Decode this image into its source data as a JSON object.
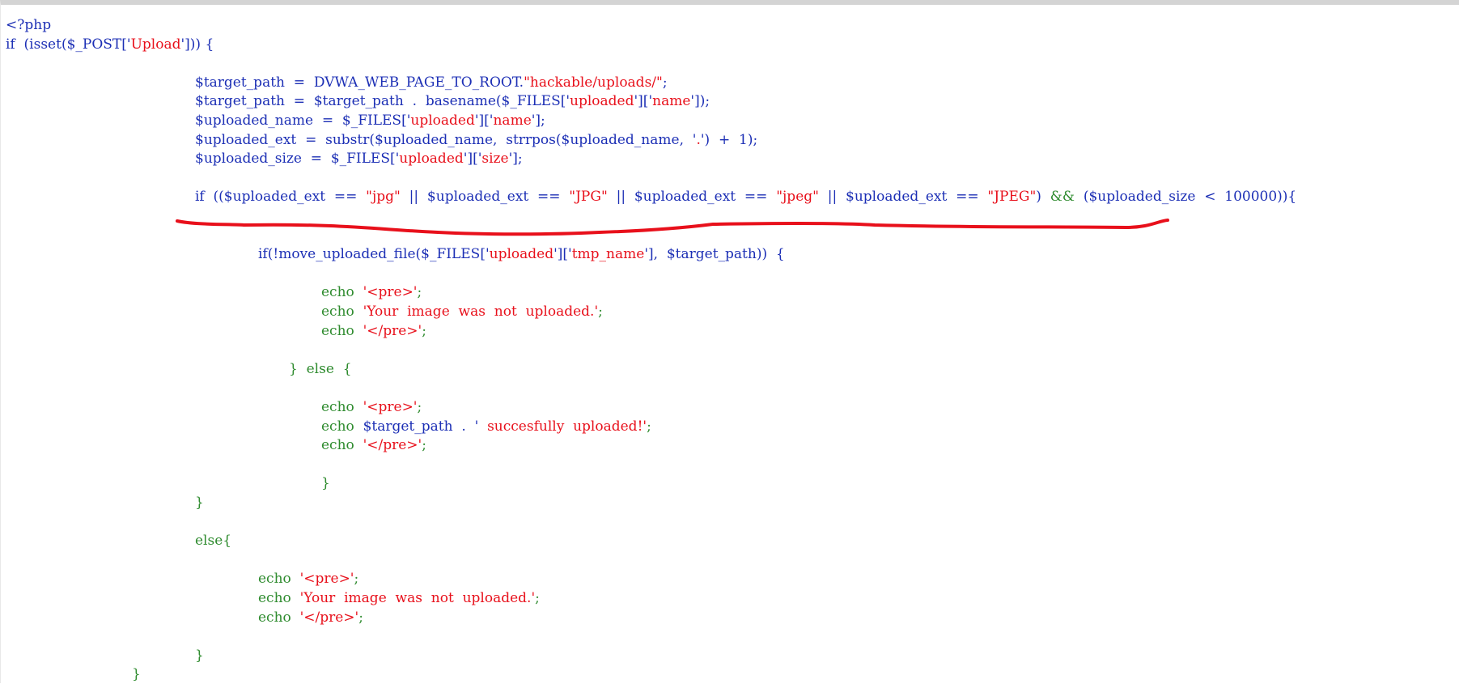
{
  "editor": {
    "lines": [
      {
        "tokens": [
          {
            "text": "<?php",
            "c": "b"
          }
        ]
      },
      {
        "tokens": [
          {
            "text": "if  (",
            "c": "b"
          },
          {
            "text": "isset",
            "c": "b"
          },
          {
            "text": "($_POST['",
            "c": "b"
          },
          {
            "text": "Upload",
            "c": "s"
          },
          {
            "text": "'])) {",
            "c": "b"
          }
        ]
      },
      {
        "tokens": []
      },
      {
        "tokens": [
          {
            "text": "$target_path  =  DVWA_WEB_PAGE_TO_ROOT.",
            "c": "b"
          },
          {
            "text": "\"hackable/uploads/\"",
            "c": "s"
          },
          {
            "text": ";",
            "c": "b"
          }
        ]
      },
      {
        "tokens": [
          {
            "text": "$target_path  =  $target_path  .  basename($_FILES['",
            "c": "b"
          },
          {
            "text": "uploaded",
            "c": "s"
          },
          {
            "text": "']['",
            "c": "b"
          },
          {
            "text": "name",
            "c": "s"
          },
          {
            "text": "']);",
            "c": "b"
          }
        ]
      },
      {
        "tokens": [
          {
            "text": "$uploaded_name  =  $_FILES['",
            "c": "b"
          },
          {
            "text": "uploaded",
            "c": "s"
          },
          {
            "text": "']['",
            "c": "b"
          },
          {
            "text": "name",
            "c": "s"
          },
          {
            "text": "'];",
            "c": "b"
          }
        ]
      },
      {
        "tokens": [
          {
            "text": "$uploaded_ext  =  substr($uploaded_name,  strrpos($uploaded_name,  '",
            "c": "b"
          },
          {
            "text": ".",
            "c": "s"
          },
          {
            "text": "')  +  1);",
            "c": "b"
          }
        ]
      },
      {
        "tokens": [
          {
            "text": "$uploaded_size  =  $_FILES['",
            "c": "b"
          },
          {
            "text": "uploaded",
            "c": "s"
          },
          {
            "text": "']['",
            "c": "b"
          },
          {
            "text": "size",
            "c": "s"
          },
          {
            "text": "'];",
            "c": "b"
          }
        ]
      },
      {
        "tokens": []
      },
      {
        "tokens": [
          {
            "text": "if  (($uploaded_ext  ==  ",
            "c": "b"
          },
          {
            "text": "\"jpg\"",
            "c": "s"
          },
          {
            "text": "  ||  $uploaded_ext  ==  ",
            "c": "b"
          },
          {
            "text": "\"JPG\"",
            "c": "s"
          },
          {
            "text": "  ||  $uploaded_ext  ==  ",
            "c": "b"
          },
          {
            "text": "\"jpeg\"",
            "c": "s"
          },
          {
            "text": "  ||  $uploaded_ext  ==  ",
            "c": "b"
          },
          {
            "text": "\"JPEG\"",
            "c": "s"
          },
          {
            "text": ")  ",
            "c": "b"
          },
          {
            "text": "&&",
            "c": "k"
          },
          {
            "text": "  ($uploaded_size  <  100000)){",
            "c": "b"
          }
        ]
      },
      {
        "tokens": []
      },
      {
        "tokens": []
      },
      {
        "tokens": [
          {
            "text": "if(!move_uploaded_file($_FILES['",
            "c": "b"
          },
          {
            "text": "uploaded",
            "c": "s"
          },
          {
            "text": "']['",
            "c": "b"
          },
          {
            "text": "tmp_name",
            "c": "s"
          },
          {
            "text": "'],  $target_path))  {",
            "c": "b"
          }
        ]
      },
      {
        "tokens": []
      },
      {
        "tokens": [
          {
            "text": "echo  ",
            "c": "k"
          },
          {
            "text": "'<pre>'",
            "c": "s"
          },
          {
            "text": ";",
            "c": "k"
          }
        ]
      },
      {
        "tokens": [
          {
            "text": "echo  ",
            "c": "k"
          },
          {
            "text": "'Your  image  was  not  uploaded.'",
            "c": "s"
          },
          {
            "text": ";",
            "c": "k"
          }
        ]
      },
      {
        "tokens": [
          {
            "text": "echo  ",
            "c": "k"
          },
          {
            "text": "'</pre>'",
            "c": "s"
          },
          {
            "text": ";",
            "c": "k"
          }
        ]
      },
      {
        "tokens": []
      },
      {
        "tokens": [
          {
            "text": "}  else  {",
            "c": "k"
          }
        ]
      },
      {
        "tokens": []
      },
      {
        "tokens": [
          {
            "text": "echo  ",
            "c": "k"
          },
          {
            "text": "'<pre>'",
            "c": "s"
          },
          {
            "text": ";",
            "c": "k"
          }
        ]
      },
      {
        "tokens": [
          {
            "text": "echo  ",
            "c": "k"
          },
          {
            "text": "$target_path  .  '",
            "c": "b"
          },
          {
            "text": "  succesfully  uploaded!'",
            "c": "s"
          },
          {
            "text": ";",
            "c": "k"
          }
        ]
      },
      {
        "tokens": [
          {
            "text": "echo  ",
            "c": "k"
          },
          {
            "text": "'</pre>'",
            "c": "s"
          },
          {
            "text": ";",
            "c": "k"
          }
        ]
      },
      {
        "tokens": []
      },
      {
        "tokens": [
          {
            "text": "}",
            "c": "k"
          }
        ]
      },
      {
        "tokens": [
          {
            "text": "}",
            "c": "k"
          }
        ]
      },
      {
        "tokens": []
      },
      {
        "tokens": [
          {
            "text": "else{",
            "c": "k"
          }
        ]
      },
      {
        "tokens": []
      },
      {
        "tokens": [
          {
            "text": "echo  ",
            "c": "k"
          },
          {
            "text": "'<pre>'",
            "c": "s"
          },
          {
            "text": ";",
            "c": "k"
          }
        ]
      },
      {
        "tokens": [
          {
            "text": "echo  ",
            "c": "k"
          },
          {
            "text": "'Your  image  was  not  uploaded.'",
            "c": "s"
          },
          {
            "text": ";",
            "c": "k"
          }
        ]
      },
      {
        "tokens": [
          {
            "text": "echo  ",
            "c": "k"
          },
          {
            "text": "'</pre>'",
            "c": "s"
          },
          {
            "text": ";",
            "c": "k"
          }
        ]
      },
      {
        "tokens": []
      },
      {
        "tokens": [
          {
            "text": "}",
            "c": "k"
          }
        ]
      },
      {
        "tokens": [
          {
            "text": "}",
            "c": "k"
          }
        ]
      }
    ]
  },
  "colors": {
    "keyword": "#2e8b2e",
    "identifier": "#1c2fb5",
    "string": "#e8101b",
    "annotation": "#e8101b"
  }
}
